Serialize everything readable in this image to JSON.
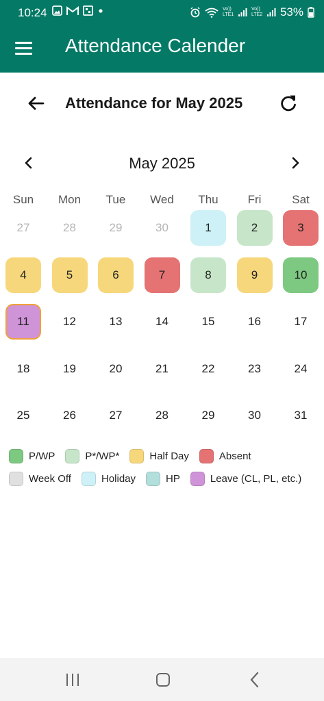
{
  "status_bar": {
    "time": "10:24",
    "battery": "53%",
    "net1": "Vo)) LTE1",
    "net2": "Vo)) LTE2"
  },
  "app_bar": {
    "title": "Attendance Calender"
  },
  "attendance": {
    "title": "Attendance for May 2025"
  },
  "calendar": {
    "month_label": "May 2025",
    "weekdays": [
      "Sun",
      "Mon",
      "Tue",
      "Wed",
      "Thu",
      "Fri",
      "Sat"
    ],
    "days": [
      {
        "label": "27",
        "muted": true,
        "status": "none"
      },
      {
        "label": "28",
        "muted": true,
        "status": "none"
      },
      {
        "label": "29",
        "muted": true,
        "status": "none"
      },
      {
        "label": "30",
        "muted": true,
        "status": "none"
      },
      {
        "label": "1",
        "muted": false,
        "status": "holiday"
      },
      {
        "label": "2",
        "muted": false,
        "status": "p_star"
      },
      {
        "label": "3",
        "muted": false,
        "status": "absent"
      },
      {
        "label": "4",
        "muted": false,
        "status": "half_day"
      },
      {
        "label": "5",
        "muted": false,
        "status": "half_day"
      },
      {
        "label": "6",
        "muted": false,
        "status": "half_day"
      },
      {
        "label": "7",
        "muted": false,
        "status": "absent"
      },
      {
        "label": "8",
        "muted": false,
        "status": "p_star"
      },
      {
        "label": "9",
        "muted": false,
        "status": "half_day"
      },
      {
        "label": "10",
        "muted": false,
        "status": "present"
      },
      {
        "label": "11",
        "muted": false,
        "status": "leave",
        "today": true
      },
      {
        "label": "12",
        "muted": false,
        "status": "none"
      },
      {
        "label": "13",
        "muted": false,
        "status": "none"
      },
      {
        "label": "14",
        "muted": false,
        "status": "none"
      },
      {
        "label": "15",
        "muted": false,
        "status": "none"
      },
      {
        "label": "16",
        "muted": false,
        "status": "none"
      },
      {
        "label": "17",
        "muted": false,
        "status": "none"
      },
      {
        "label": "18",
        "muted": false,
        "status": "none"
      },
      {
        "label": "19",
        "muted": false,
        "status": "none"
      },
      {
        "label": "20",
        "muted": false,
        "status": "none"
      },
      {
        "label": "21",
        "muted": false,
        "status": "none"
      },
      {
        "label": "22",
        "muted": false,
        "status": "none"
      },
      {
        "label": "23",
        "muted": false,
        "status": "none"
      },
      {
        "label": "24",
        "muted": false,
        "status": "none"
      },
      {
        "label": "25",
        "muted": false,
        "status": "none"
      },
      {
        "label": "26",
        "muted": false,
        "status": "none"
      },
      {
        "label": "27",
        "muted": false,
        "status": "none"
      },
      {
        "label": "28",
        "muted": false,
        "status": "none"
      },
      {
        "label": "29",
        "muted": false,
        "status": "none"
      },
      {
        "label": "30",
        "muted": false,
        "status": "none"
      },
      {
        "label": "31",
        "muted": false,
        "status": "none"
      }
    ]
  },
  "legend": {
    "rows": [
      [
        {
          "key": "present",
          "label": "P/WP"
        },
        {
          "key": "p_star",
          "label": "P*/WP*"
        },
        {
          "key": "half_day",
          "label": "Half Day"
        },
        {
          "key": "absent",
          "label": "Absent"
        }
      ],
      [
        {
          "key": "week_off",
          "label": "Week Off"
        },
        {
          "key": "holiday",
          "label": "Holiday"
        },
        {
          "key": "hp",
          "label": "HP"
        },
        {
          "key": "leave",
          "label": "Leave (CL, PL, etc.)"
        }
      ]
    ]
  },
  "colors": {
    "brand": "#047a66",
    "today_border": "#f0a13a",
    "present": "#7dc981",
    "p_star": "#c7e6c9",
    "half_day": "#f7d77c",
    "absent": "#e57373",
    "week_off": "#e0e0e0",
    "holiday": "#cdf1f6",
    "hp": "#b2dfdb",
    "leave": "#cf93d8",
    "none": "transparent"
  }
}
